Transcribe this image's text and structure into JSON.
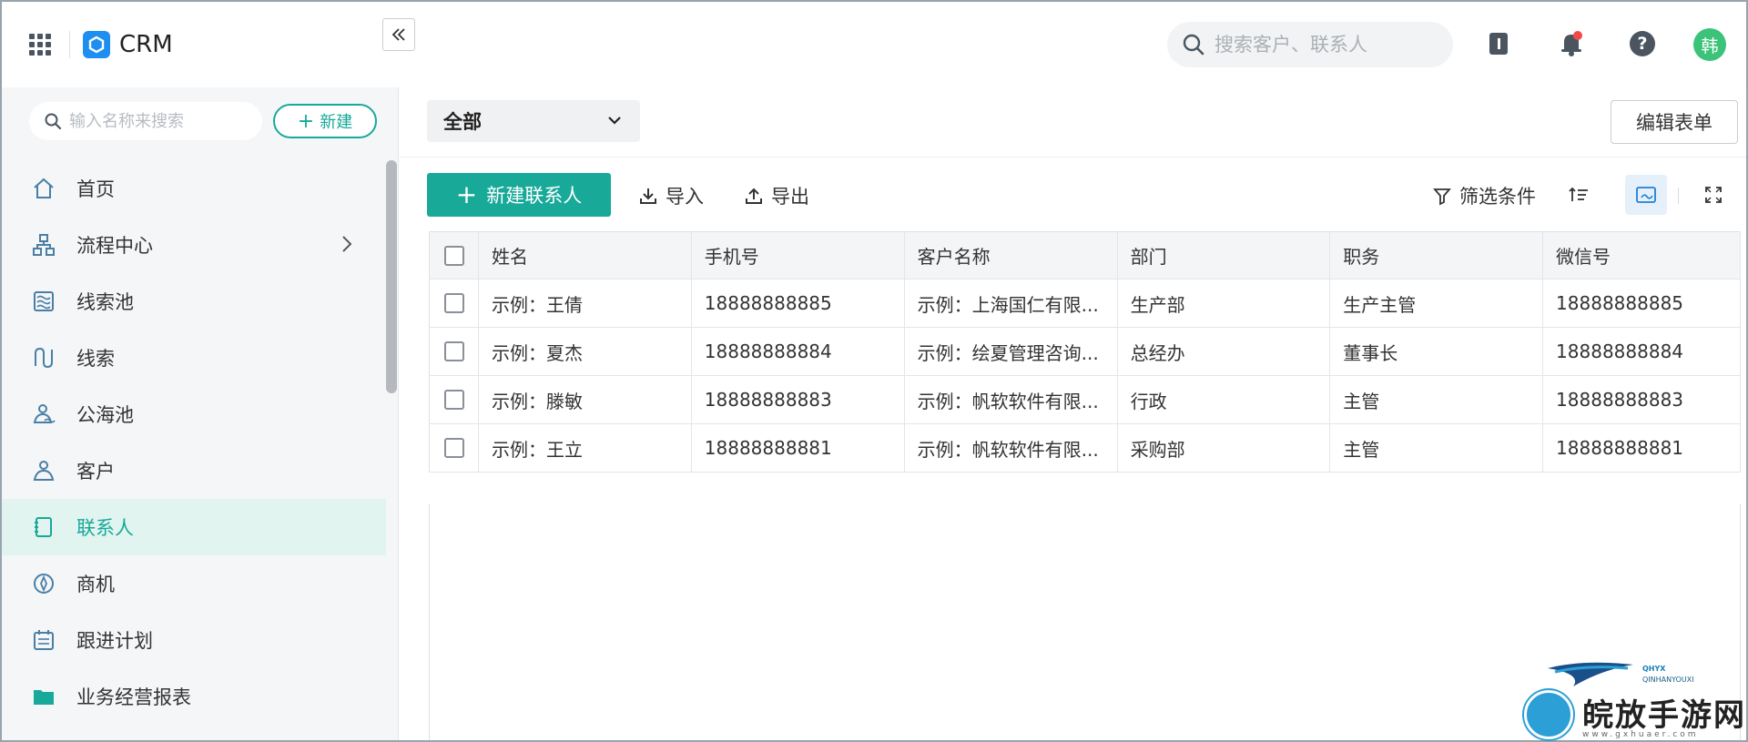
{
  "app": {
    "name": "CRM"
  },
  "header": {
    "search_placeholder": "搜索客户、联系人",
    "avatar_text": "韩"
  },
  "sidebar": {
    "search_placeholder": "输入名称来搜索",
    "new_label": "新建",
    "items": [
      {
        "label": "首页",
        "icon": "home-icon"
      },
      {
        "label": "流程中心",
        "icon": "flow-icon",
        "has_submenu": true
      },
      {
        "label": "线索池",
        "icon": "lead-pool-icon"
      },
      {
        "label": "线索",
        "icon": "lead-icon"
      },
      {
        "label": "公海池",
        "icon": "public-pool-icon"
      },
      {
        "label": "客户",
        "icon": "customer-icon"
      },
      {
        "label": "联系人",
        "icon": "contact-icon",
        "active": true
      },
      {
        "label": "商机",
        "icon": "opportunity-icon"
      },
      {
        "label": "跟进计划",
        "icon": "follow-plan-icon"
      },
      {
        "label": "业务经营报表",
        "icon": "folder-icon"
      }
    ]
  },
  "main": {
    "view_select": "全部",
    "edit_form_label": "编辑表单",
    "new_contact_label": "新建联系人",
    "import_label": "导入",
    "export_label": "导出",
    "filter_label": "筛选条件"
  },
  "table": {
    "columns": [
      "姓名",
      "手机号",
      "客户名称",
      "部门",
      "职务",
      "微信号"
    ],
    "rows": [
      [
        "示例：王倩",
        "18888888885",
        "示例：上海国仁有限...",
        "生产部",
        "生产主管",
        "18888888885"
      ],
      [
        "示例：夏杰",
        "18888888884",
        "示例：绘夏管理咨询...",
        "总经办",
        "董事长",
        "18888888884"
      ],
      [
        "示例：滕敏",
        "18888888883",
        "示例：帆软软件有限...",
        "行政",
        "主管",
        "18888888883"
      ],
      [
        "示例：王立",
        "18888888881",
        "示例：帆软软件有限...",
        "采购部",
        "主管",
        "18888888881"
      ]
    ]
  },
  "watermark": {
    "brand": "QHYX",
    "brand_sub": "QINHANYOUXI",
    "text": "皖放手游网",
    "url": "www.gxhuaer.com"
  },
  "colors": {
    "accent": "#18a999",
    "active_bg": "#e1f4ef",
    "avatar": "#3cc37a",
    "logo": "#1f8ef1"
  }
}
